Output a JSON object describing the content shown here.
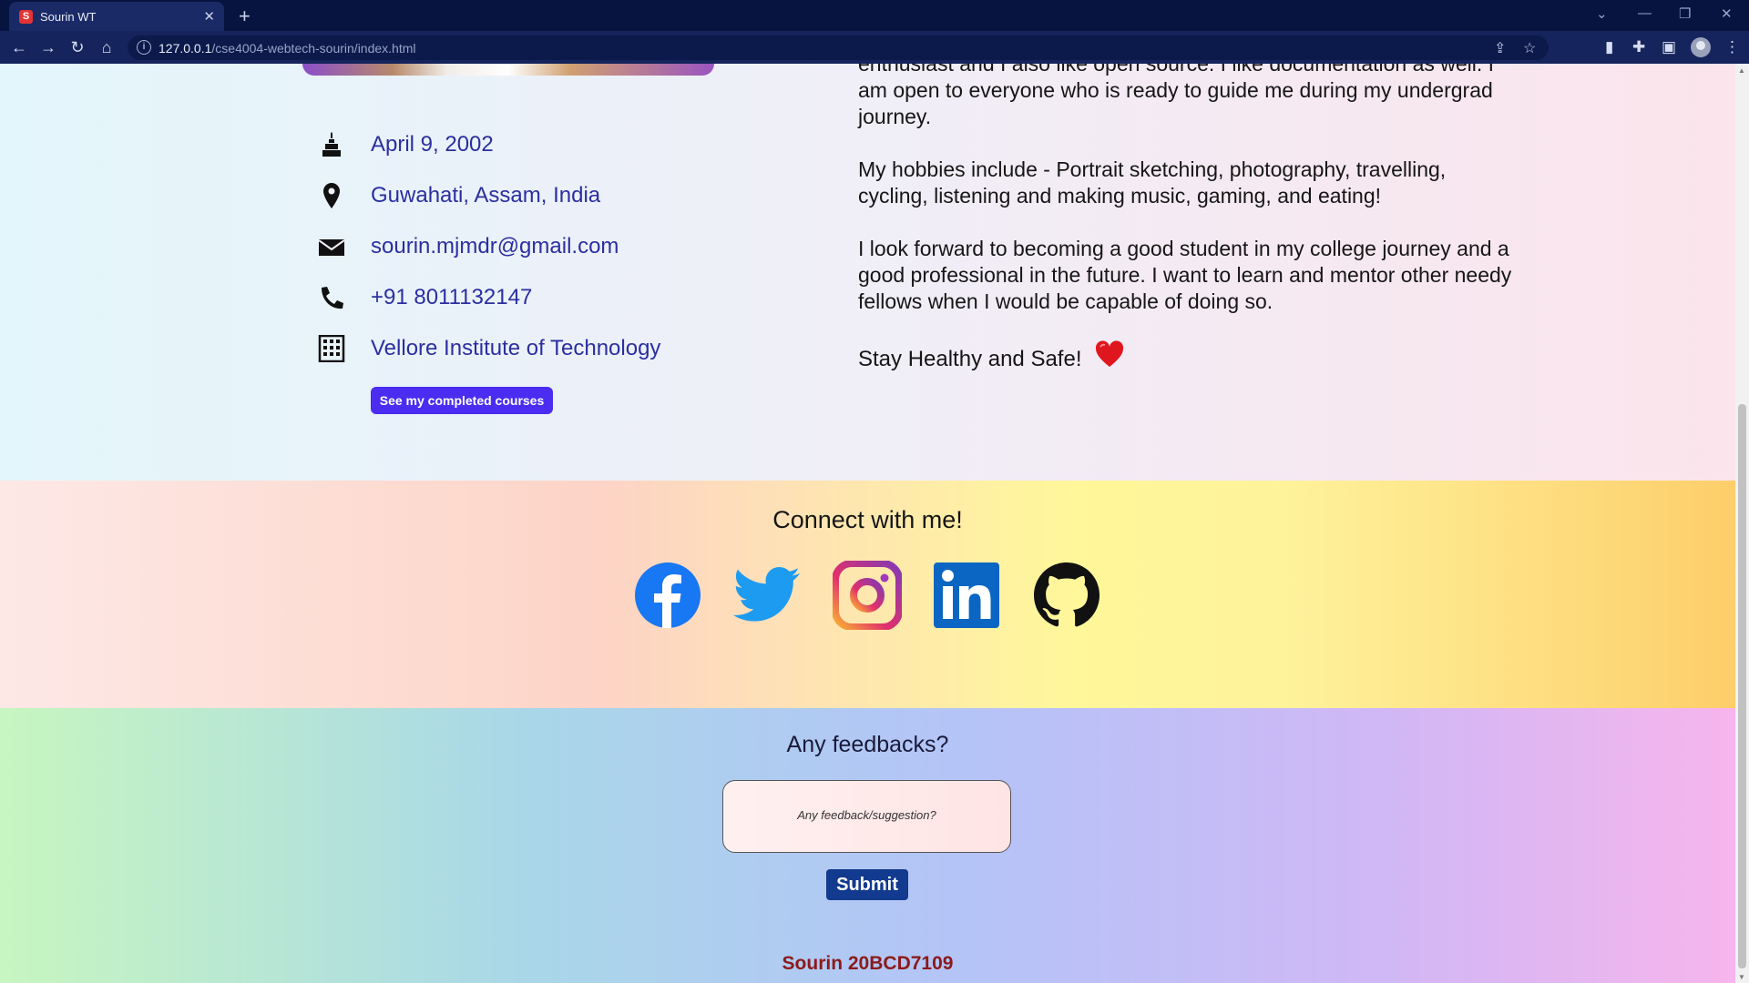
{
  "browser": {
    "tab_title": "Sourin WT",
    "favicon_letter": "S",
    "url_host": "127.0.0.1",
    "url_path": "/cse4004-webtech-sourin/index.html"
  },
  "about": {
    "info": [
      {
        "icon": "cake-icon",
        "text": "April 9, 2002"
      },
      {
        "icon": "location-pin-icon",
        "text": "Guwahati, Assam, India"
      },
      {
        "icon": "envelope-icon",
        "text": "sourin.mjmdr@gmail.com"
      },
      {
        "icon": "phone-icon",
        "text": "+91 8011132147"
      },
      {
        "icon": "building-icon",
        "text": "Vellore Institute of Technology"
      }
    ],
    "courses_button": "See my completed courses",
    "bio": [
      "enthusiast and I also like open source. I like documentation as well. I am open to everyone who is ready to guide me during my undergrad journey.",
      "My hobbies include - Portrait sketching, photography, travelling, cycling, listening and making music, gaming, and eating!",
      "I look forward to becoming a good student in my college journey and a good professional in the future. I want to learn and mentor other needy fellows when I would be capable of doing so."
    ],
    "closing": "Stay Healthy and Safe!"
  },
  "connect": {
    "title": "Connect with me!",
    "socials": [
      "facebook-icon",
      "twitter-icon",
      "instagram-icon",
      "linkedin-icon",
      "github-icon"
    ]
  },
  "feedback": {
    "title": "Any feedbacks?",
    "placeholder": "Any feedback/suggestion?",
    "submit_label": "Submit",
    "footer": "Sourin 20BCD7109"
  }
}
